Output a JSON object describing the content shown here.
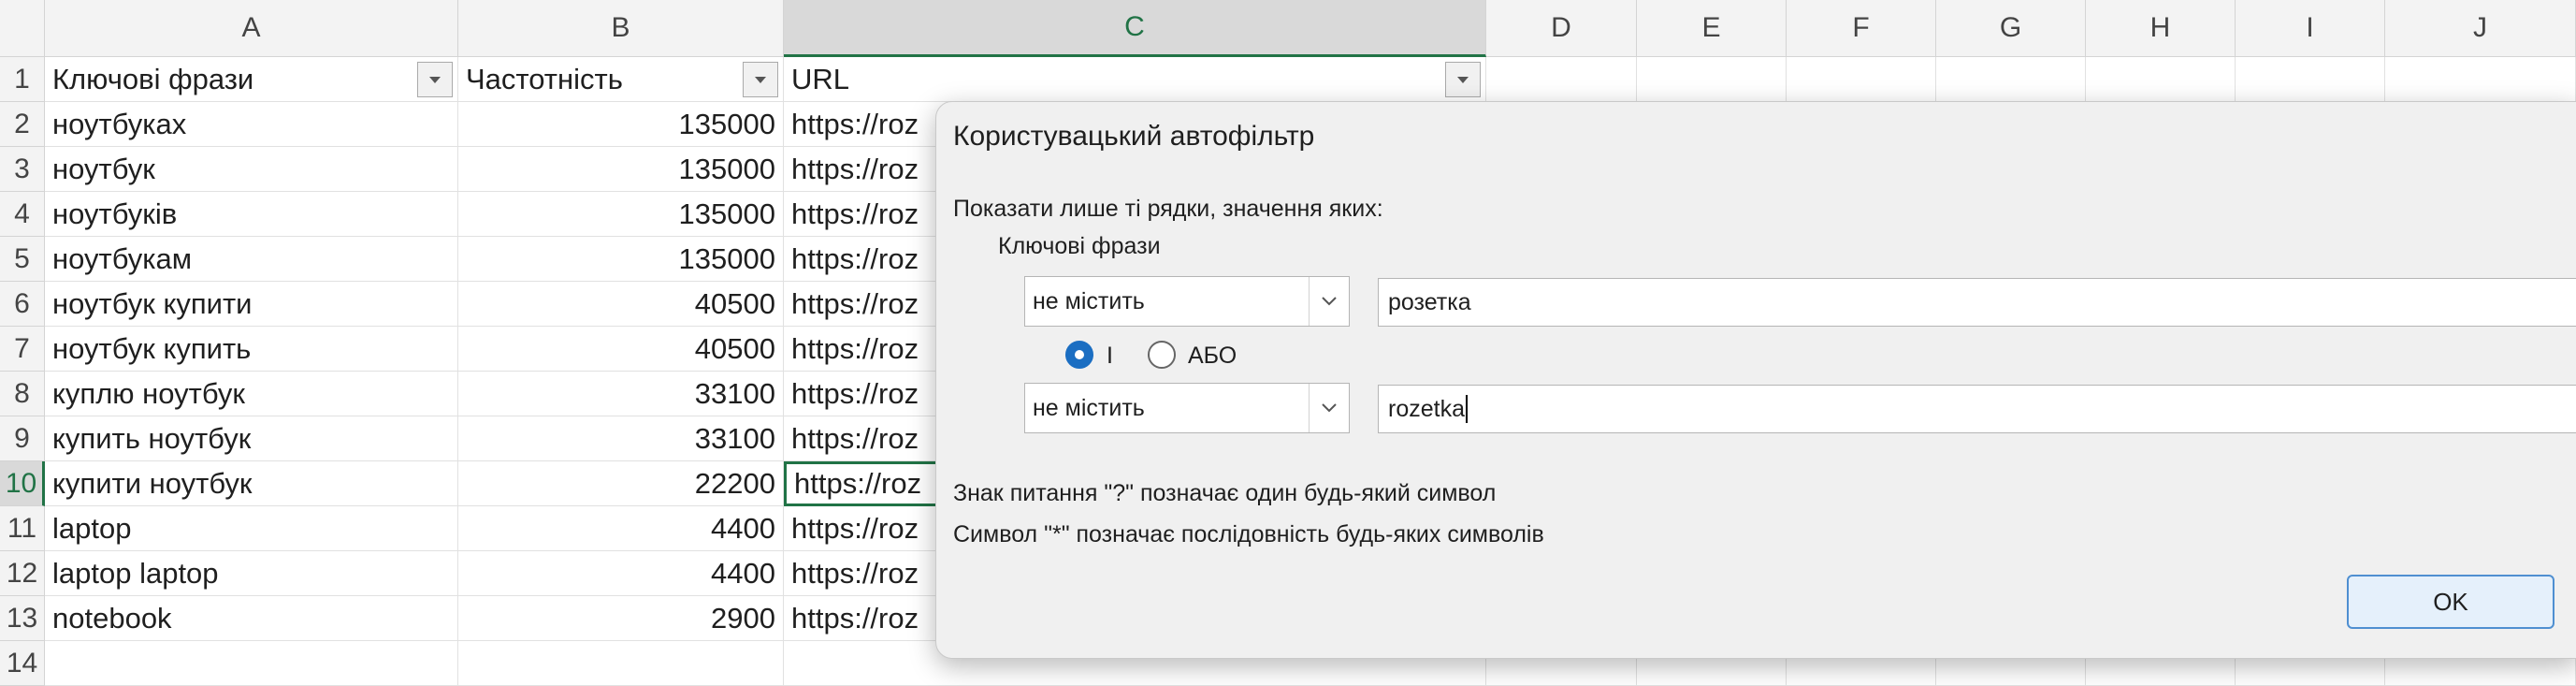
{
  "spreadsheet": {
    "column_headers": [
      "A",
      "B",
      "C",
      "D",
      "E",
      "F",
      "G",
      "H",
      "I",
      "J"
    ],
    "row_numbers": [
      "1",
      "2",
      "3",
      "4",
      "5",
      "6",
      "7",
      "8",
      "9",
      "10",
      "11",
      "12",
      "13",
      "14"
    ],
    "header_row": {
      "col_a": "Ключові фрази",
      "col_b": "Частотність",
      "col_c": "URL"
    },
    "rows": [
      {
        "phrase": "ноутбуках",
        "freq": "135000",
        "url": "https://roz"
      },
      {
        "phrase": "ноутбук",
        "freq": "135000",
        "url": "https://roz"
      },
      {
        "phrase": "ноутбуків",
        "freq": "135000",
        "url": "https://roz"
      },
      {
        "phrase": "ноутбукам",
        "freq": "135000",
        "url": "https://roz"
      },
      {
        "phrase": "ноутбук купити",
        "freq": "40500",
        "url": "https://roz"
      },
      {
        "phrase": "ноутбук купить",
        "freq": "40500",
        "url": "https://roz"
      },
      {
        "phrase": "куплю ноутбук",
        "freq": "33100",
        "url": "https://roz"
      },
      {
        "phrase": "купить ноутбук",
        "freq": "33100",
        "url": "https://roz"
      },
      {
        "phrase": "купити ноутбук",
        "freq": "22200",
        "url": "https://roz"
      },
      {
        "phrase": "laptop",
        "freq": "4400",
        "url": "https://roz"
      },
      {
        "phrase": "laptop laptop",
        "freq": "4400",
        "url": "https://roz"
      },
      {
        "phrase": "notebook",
        "freq": "2900",
        "url": "https://roz"
      }
    ],
    "selected_column": "C",
    "active_row": "10"
  },
  "dialog": {
    "title": "Користувацький автофільтр",
    "prompt": "Показати лише ті рядки, значення яких:",
    "field_label": "Ключові фрази",
    "condition1": {
      "operator": "не містить",
      "value": "розетка"
    },
    "logic_and_label": "І",
    "logic_or_label": "АБО",
    "logic_selected": "and",
    "condition2": {
      "operator": "не містить",
      "value": "rozetka"
    },
    "hint1": "Знак питання \"?\" позначає один будь-який символ",
    "hint2": "Символ \"*\" позначає послідовність будь-яких символів",
    "ok_label": "OK"
  },
  "colors": {
    "accent_green": "#217346",
    "radio_blue": "#1b6ec2",
    "button_border": "#4f8fd1"
  },
  "icons": {
    "filter_dropdown": "chevron-down-icon",
    "combo_arrow": "chevron-down-icon"
  }
}
